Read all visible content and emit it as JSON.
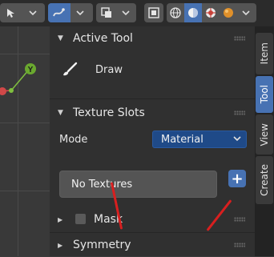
{
  "toolbar": {
    "icons": [
      "cursor-mode-icon",
      "draw-tool-icon",
      "view-overlay-icon",
      "xray-icon",
      "wireframe-icon",
      "solid-icon",
      "material-preview-icon",
      "rendered-icon"
    ]
  },
  "panel": {
    "active_tool": {
      "header": "Active Tool",
      "tool_name": "Draw"
    },
    "texture_slots": {
      "header": "Texture Slots",
      "mode_label": "Mode",
      "mode_value": "Material",
      "list_text": "No Textures",
      "add_label": "+"
    },
    "mask": {
      "header": "Mask",
      "checked": false
    },
    "symmetry": {
      "header": "Symmetry"
    }
  },
  "tabs": [
    {
      "label": "Item",
      "active": false
    },
    {
      "label": "Tool",
      "active": true
    },
    {
      "label": "View",
      "active": false
    },
    {
      "label": "Create",
      "active": false
    }
  ],
  "colors": {
    "accent": "#4772b3",
    "dropdown_bg": "#1f4a88",
    "annotation": "#d81f1f"
  }
}
